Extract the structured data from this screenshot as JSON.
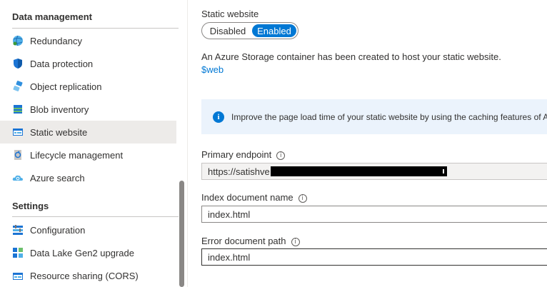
{
  "sidebar": {
    "data_management": {
      "title": "Data management",
      "items": [
        {
          "label": "Redundancy",
          "icon": "globe-icon"
        },
        {
          "label": "Data protection",
          "icon": "shield-icon"
        },
        {
          "label": "Object replication",
          "icon": "replication-icon"
        },
        {
          "label": "Blob inventory",
          "icon": "inventory-icon"
        },
        {
          "label": "Static website",
          "icon": "website-icon",
          "selected": true
        },
        {
          "label": "Lifecycle management",
          "icon": "lifecycle-icon"
        },
        {
          "label": "Azure search",
          "icon": "cloud-search-icon"
        }
      ]
    },
    "settings": {
      "title": "Settings",
      "items": [
        {
          "label": "Configuration",
          "icon": "configuration-icon"
        },
        {
          "label": "Data Lake Gen2 upgrade",
          "icon": "data-lake-icon"
        },
        {
          "label": "Resource sharing (CORS)",
          "icon": "cors-icon"
        }
      ]
    }
  },
  "main": {
    "static_website_label": "Static website",
    "toggle": {
      "off_label": "Disabled",
      "on_label": "Enabled",
      "selected": "Enabled"
    },
    "description": "An Azure Storage container has been created to host your static website.",
    "container_link": "$web",
    "banner_text": "Improve the page load time of your static website by using the caching features of Azure Front Door",
    "primary_endpoint": {
      "label": "Primary endpoint",
      "value": "https://satishve"
    },
    "index_document": {
      "label": "Index document name",
      "value": "index.html"
    },
    "error_document": {
      "label": "Error document path",
      "value": "index.html"
    }
  },
  "colors": {
    "accent": "#0078d4",
    "selected_bg": "#edebe9",
    "banner_bg": "#ebf3fc"
  }
}
